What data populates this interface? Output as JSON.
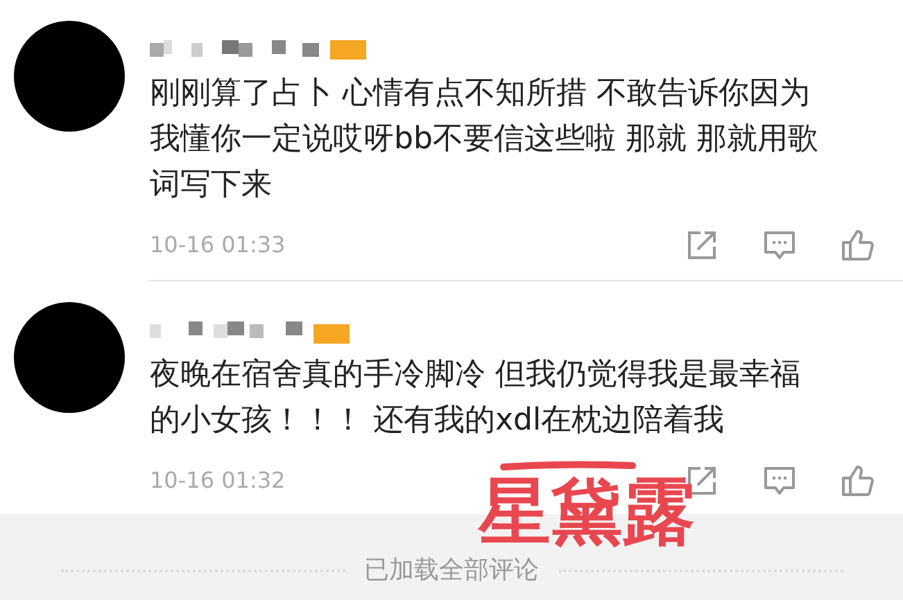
{
  "comments": [
    {
      "text_lines": [
        "刚刚算了占卜 心情有点不知所措 不敢告诉你因为",
        "我懂你一定说哎呀bb不要信这些啦 那就 那就用歌",
        "词写下来"
      ],
      "time": "10-16 01:33"
    },
    {
      "text_lines": [
        "夜晚在宿舍真的手冷脚冷 但我仍觉得我是最幸福",
        "的小女孩！！！ 还有我的xdl在枕边陪着我"
      ],
      "time": "10-16 01:32"
    }
  ],
  "annotation": {
    "text": "星黛露"
  },
  "footer": {
    "text": "已加载全部评论"
  }
}
